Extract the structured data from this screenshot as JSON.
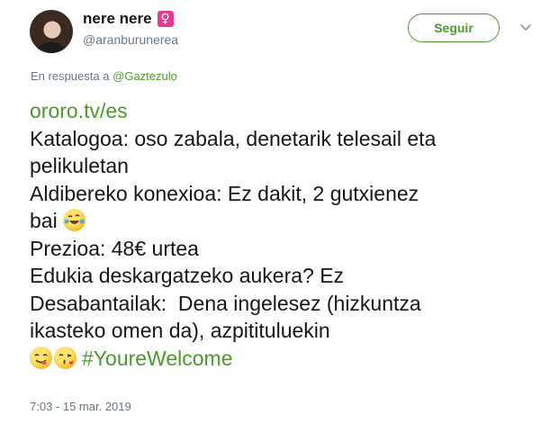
{
  "author": {
    "name": "nere nere",
    "handle": "@aranburunerea",
    "gender_symbol": "♀",
    "avatar_icon": "user-avatar"
  },
  "follow_button": {
    "label": "Seguir"
  },
  "menu": {
    "icon": "chevron-down-icon"
  },
  "reply_to": {
    "prefix": "En respuesta a",
    "user": "@Gaztezulo"
  },
  "tweet": {
    "link": "ororo.tv/es",
    "lines": [
      "Katalogoa: oso zabala, denetarik telesail eta",
      "pelikuletan",
      "Aldibereko konexioa: Ez dakit, 2 gutxienez",
      "bai",
      "Prezioa: 48€ urtea",
      "Edukia deskargatzeko aukera? Ez",
      "Desabantailak:  Dena ingelesez (hizkuntza",
      "ikasteko omen da), azpitituluekin"
    ],
    "emojis": {
      "after_line_4": "rofl-emoji",
      "final": [
        "yum-emoji",
        "kiss-emoji"
      ]
    },
    "hashtag": "#YoureWelcome"
  },
  "timestamp": "7:03 - 15 mar. 2019",
  "colors": {
    "accent": "#4a9a2a",
    "muted": "#657786",
    "text": "#14171a",
    "venus_badge": "#e23b8f"
  }
}
